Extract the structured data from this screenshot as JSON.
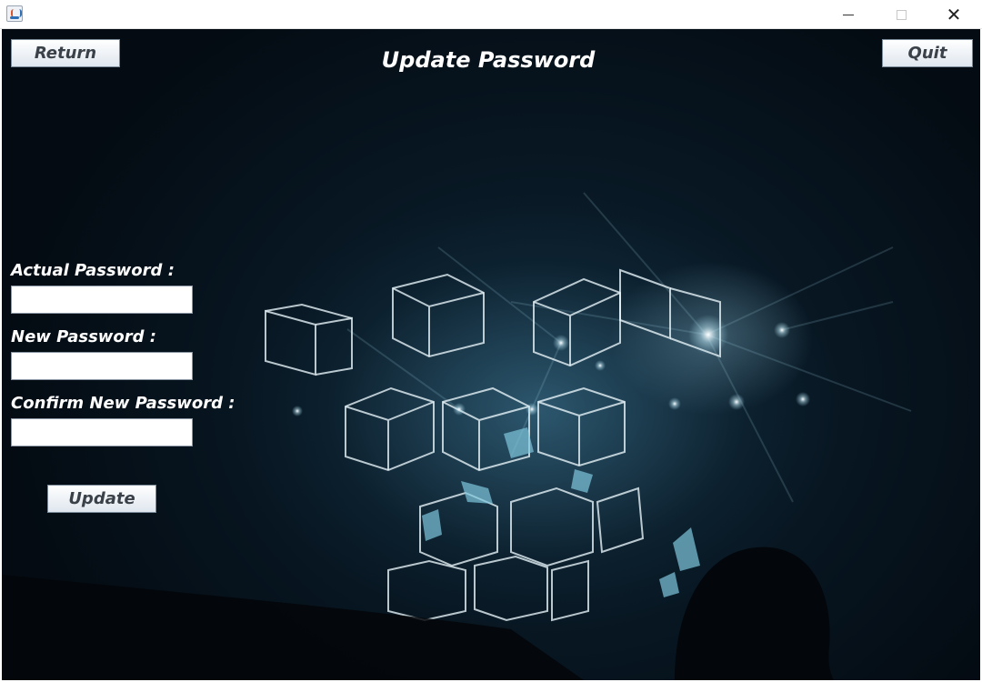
{
  "window": {
    "title": "",
    "controls": [
      "minimize-icon",
      "maximize-icon",
      "close-icon"
    ],
    "close_glyph": "✕"
  },
  "toolbar": {
    "return_label": "Return",
    "quit_label": "Quit"
  },
  "header": {
    "title": "Update Password"
  },
  "form": {
    "actual_password_label": "Actual Password :",
    "actual_password_value": "",
    "new_password_label": "New Password :",
    "new_password_value": "",
    "confirm_password_label": "Confirm New Password :",
    "confirm_password_value": "",
    "update_label": "Update"
  },
  "colors": {
    "background": "#071520",
    "text": "#ffffff",
    "button_text": "#3a4148",
    "accent_glow": "#9fd3e6"
  }
}
